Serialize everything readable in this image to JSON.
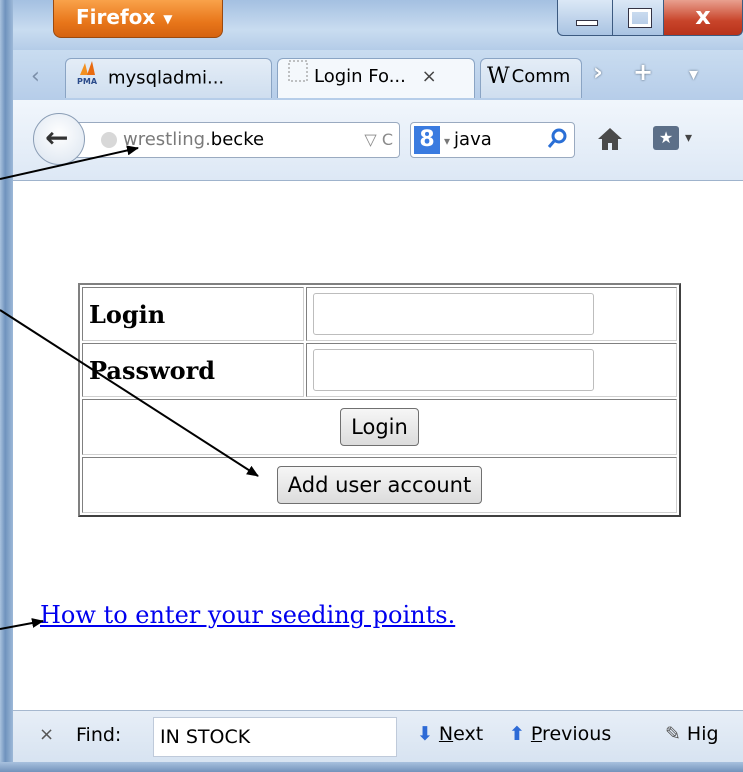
{
  "window": {
    "app_button": "Firefox",
    "controls": {
      "minimize": "–",
      "maximize": "□",
      "close": "x"
    }
  },
  "tabs": [
    {
      "label": "mysqladmi...",
      "icon": "phpmyadmin-icon",
      "icon_text": "PMA",
      "active": false
    },
    {
      "label": "Login Fo...",
      "icon": "blank-page-icon",
      "active": true,
      "close": "×"
    },
    {
      "label": "Comm",
      "icon": "wikipedia-icon",
      "icon_text": "W",
      "active": false
    }
  ],
  "tabbar": {
    "scroll_left": "‹",
    "scroll_right": "›",
    "new_tab": "+",
    "list": "▾"
  },
  "navbar": {
    "url_domain": "wrestling.",
    "url_domain_bold": "becke",
    "url_dropdown": "▽",
    "reload": "C",
    "search_engine": "8",
    "search_text": "java",
    "search_dropdown": "▾",
    "bookmark_dropdown": "▾"
  },
  "form": {
    "login_label": "Login",
    "password_label": "Password",
    "login_value": "",
    "password_value": "",
    "login_button": "Login",
    "add_account_button": "Add user account"
  },
  "link": {
    "text": "How to enter your seeding points."
  },
  "findbar": {
    "close": "×",
    "label": "Find:",
    "query": "IN STOCK",
    "next_access_key": "N",
    "next_rest": "ext",
    "prev_access_key": "P",
    "prev_rest": "revious",
    "highlight": "Hig"
  },
  "colors": {
    "firefox_orange": "#e8761a",
    "link_blue": "#0000ee",
    "close_red": "#c8442a",
    "find_arrow": "#2d6ad6"
  }
}
